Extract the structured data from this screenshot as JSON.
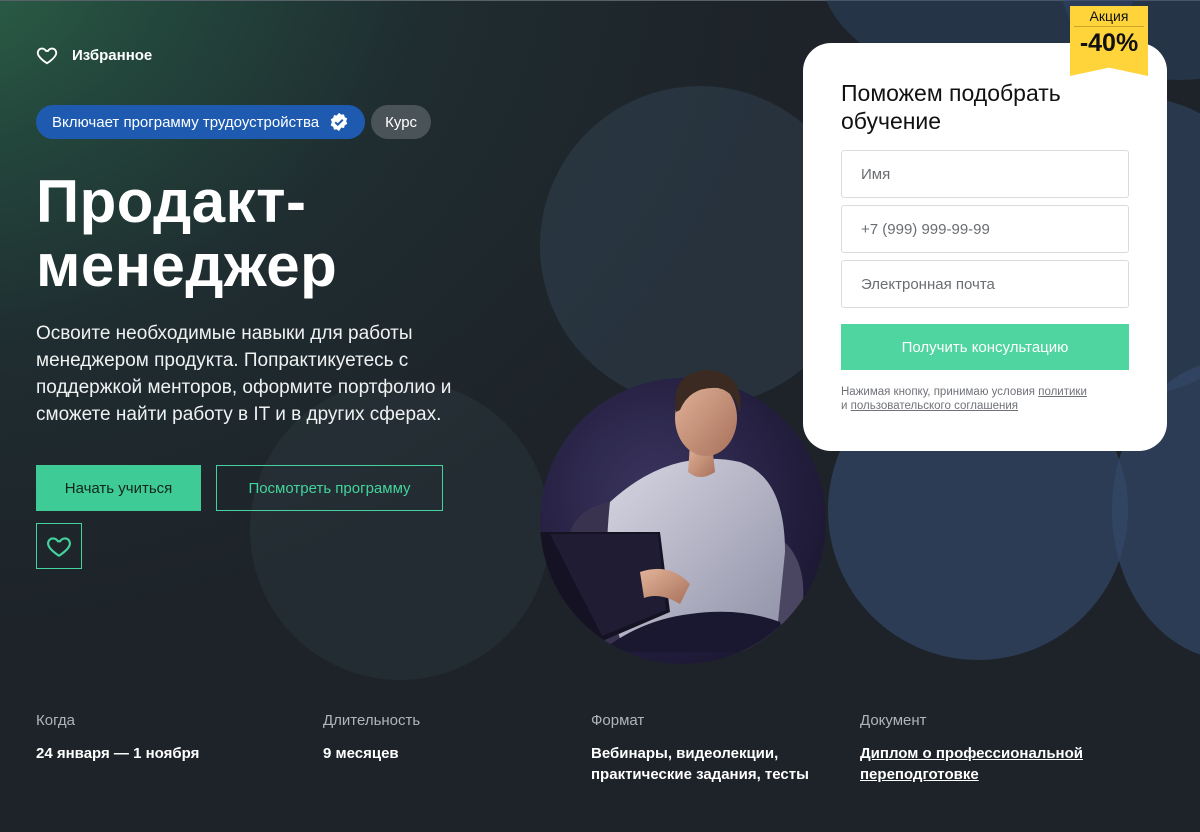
{
  "header": {
    "favorites_label": "Избранное"
  },
  "tags": {
    "program_label": "Включает программу трудоустройства",
    "course_label": "Курс"
  },
  "hero": {
    "title": "Продакт-менеджер",
    "description": "Освоите необходимые навыки для работы менеджером продукта. Попрактикуетесь с поддержкой менторов, оформите портфолио и сможете найти работу в IT и в других сферах.",
    "start_button": "Начать учиться",
    "program_button": "Посмотреть программу"
  },
  "promo": {
    "label": "Акция",
    "discount": "-40%"
  },
  "form": {
    "title": "Поможем подобрать обучение",
    "name_placeholder": "Имя",
    "phone_placeholder": "+7 (999) 999-99-99",
    "email_placeholder": "Электронная почта",
    "submit_label": "Получить консультацию",
    "terms_prefix": "Нажимая кнопку, принимаю условия",
    "terms_link1": "политики",
    "terms_and": "и",
    "terms_link2": "пользовательского соглашения"
  },
  "info": [
    {
      "label": "Когда",
      "value": "24 января — 1 ноября"
    },
    {
      "label": "Длительность",
      "value": "9 месяцев"
    },
    {
      "label": "Формат",
      "value": "Вебинары, видеолекции, практические задания, тесты"
    },
    {
      "label": "Документ",
      "value": "Диплом о профессиональной переподготовке"
    }
  ],
  "colors": {
    "accent": "#3fcb95",
    "tag_blue": "#1e5bb0",
    "promo_yellow": "#ffd43b"
  },
  "icons": [
    "heart-icon",
    "verified-check-icon"
  ]
}
